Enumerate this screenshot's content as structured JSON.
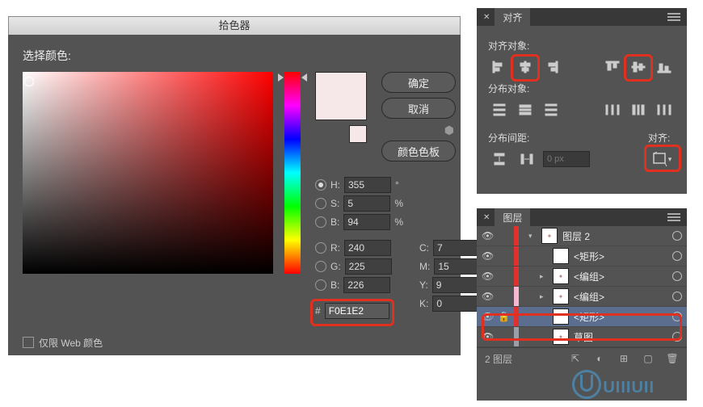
{
  "colorPicker": {
    "title": "拾色器",
    "selectLabel": "选择颜色:",
    "buttons": {
      "ok": "确定",
      "cancel": "取消",
      "swatches": "颜色色板"
    },
    "webOnly": "仅限 Web 颜色",
    "hsb": {
      "H": {
        "label": "H:",
        "value": "355",
        "unit": "°"
      },
      "S": {
        "label": "S:",
        "value": "5",
        "unit": "%"
      },
      "B": {
        "label": "B:",
        "value": "94",
        "unit": "%"
      }
    },
    "rgb": {
      "R": {
        "label": "R:",
        "value": "240"
      },
      "G": {
        "label": "G:",
        "value": "225"
      },
      "B": {
        "label": "B:",
        "value": "226"
      }
    },
    "cmyk": {
      "C": {
        "label": "C:",
        "value": "7",
        "unit": "%"
      },
      "M": {
        "label": "M:",
        "value": "15",
        "unit": "%"
      },
      "Y": {
        "label": "Y:",
        "value": "9",
        "unit": "%"
      },
      "K": {
        "label": "K:",
        "value": "0",
        "unit": "%"
      }
    },
    "hex": {
      "label": "#",
      "value": "F0E1E2"
    },
    "swatchColor": "#F0E1E2"
  },
  "align": {
    "tab": "对齐",
    "sections": {
      "alignObjects": "对齐对象:",
      "distributeObjects": "分布对象:",
      "distributeSpacing": "分布间距:",
      "alignTo": "对齐:"
    },
    "spacingValue": "0 px"
  },
  "layers": {
    "tab": "图层",
    "items": [
      {
        "name": "图层 2",
        "thumb": "img",
        "indent": 0,
        "expanded": true,
        "barColor": "red"
      },
      {
        "name": "<矩形>",
        "thumb": "white",
        "indent": 1,
        "barColor": "red"
      },
      {
        "name": "<编组>",
        "thumb": "img",
        "indent": 1,
        "twist": true,
        "barColor": "red"
      },
      {
        "name": "<编组>",
        "thumb": "img",
        "indent": 1,
        "twist": true,
        "barColor": "pink"
      },
      {
        "name": "<矩形>",
        "thumb": "white",
        "indent": 1,
        "selected": true,
        "locked": true,
        "barColor": "red"
      },
      {
        "name": "草图",
        "thumb": "img",
        "indent": 1,
        "barColor": "gray"
      }
    ],
    "footer": {
      "count": "2 图层"
    }
  }
}
